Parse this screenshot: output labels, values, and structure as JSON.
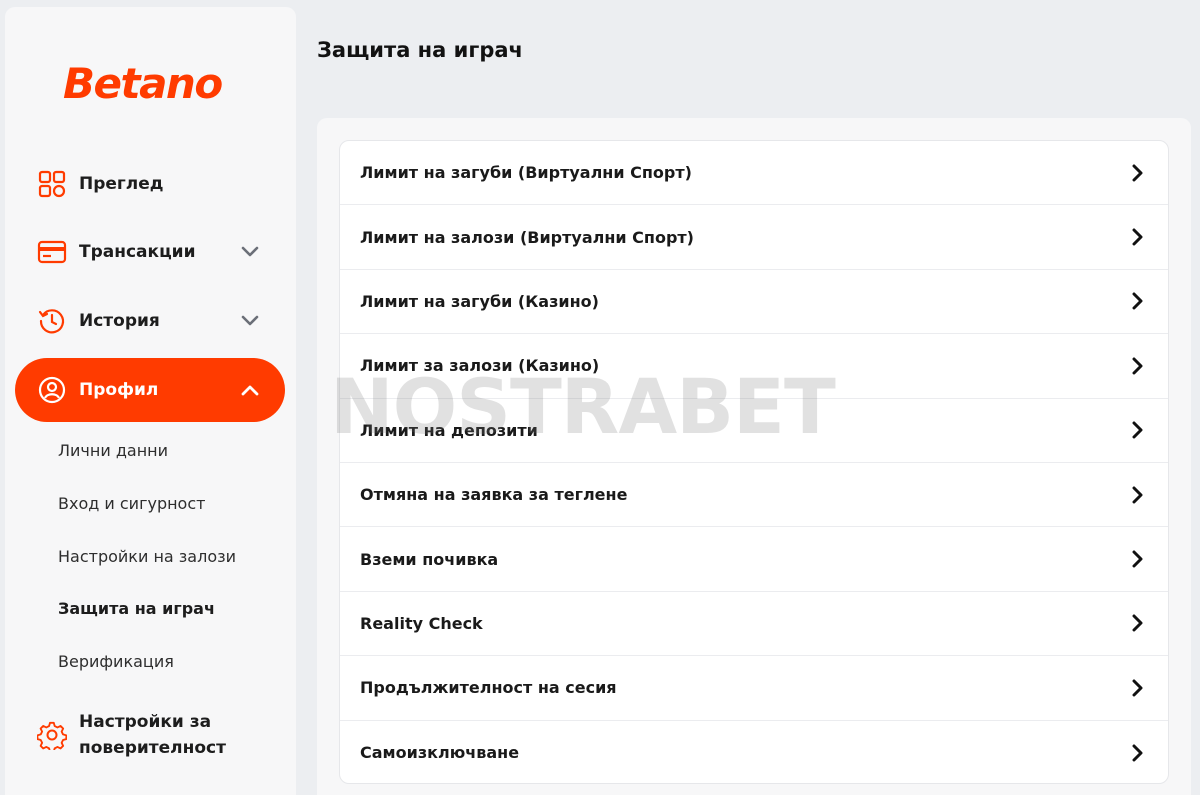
{
  "brand": {
    "logo_text": "Betano",
    "accent_color": "#ff3b00"
  },
  "sidebar": {
    "nav": [
      {
        "label": "Преглед",
        "icon": "grid-icon",
        "expanded": null
      },
      {
        "label": "Трансакции",
        "icon": "card-icon",
        "expanded": false
      },
      {
        "label": "История",
        "icon": "history-icon",
        "expanded": false
      },
      {
        "label": "Профил",
        "icon": "user-icon",
        "expanded": true,
        "active": true
      }
    ],
    "profile_sub": [
      {
        "label": "Лични данни"
      },
      {
        "label": "Вход и сигурност"
      },
      {
        "label": "Настройки на залози"
      },
      {
        "label": "Защита на играч",
        "selected": true
      },
      {
        "label": "Верификация"
      }
    ],
    "privacy": {
      "label": "Настройки за поверителност",
      "icon": "gear-icon"
    }
  },
  "main": {
    "title": "Защита на играч",
    "items": [
      {
        "label": "Лимит на загуби (Виртуални Спорт)"
      },
      {
        "label": "Лимит на залози (Виртуални Спорт)"
      },
      {
        "label": "Лимит на загуби (Казино)"
      },
      {
        "label": "Лимит за залози (Казино)"
      },
      {
        "label": "Лимит на депозити"
      },
      {
        "label": "Отмяна на заявка за теглене"
      },
      {
        "label": "Вземи почивка"
      },
      {
        "label": "Reality Check"
      },
      {
        "label": "Продължителност на сесия"
      },
      {
        "label": "Самоизключване"
      }
    ]
  },
  "watermark": "NOSTRABET"
}
